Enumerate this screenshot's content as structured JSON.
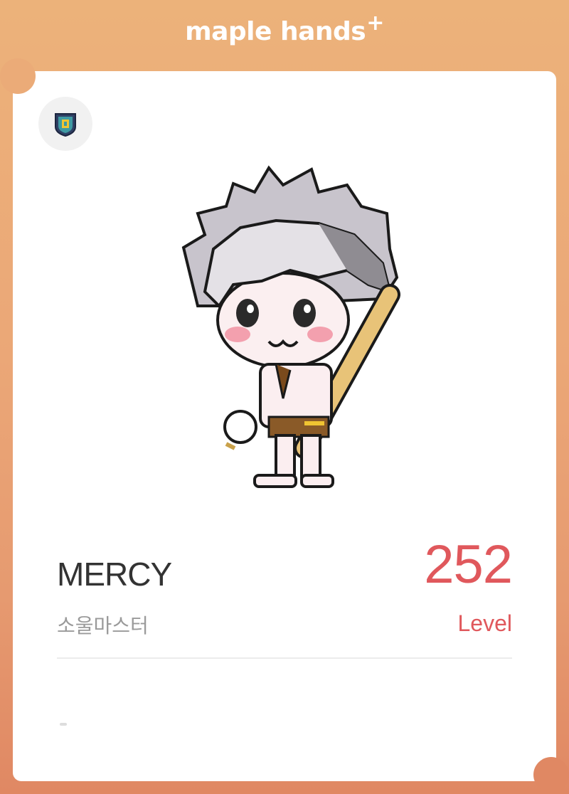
{
  "header": {
    "brand": "maple hands",
    "brand_plus": "+"
  },
  "badge": {
    "icon": "guild-shield-icon"
  },
  "avatar": {
    "icon": "character-sprite"
  },
  "character": {
    "name": "MERCY",
    "job": "소울마스터"
  },
  "level": {
    "value": "252",
    "label": "Level"
  },
  "colors": {
    "accent": "#e0585c",
    "frame": "#eba777",
    "card": "#ffffff"
  }
}
